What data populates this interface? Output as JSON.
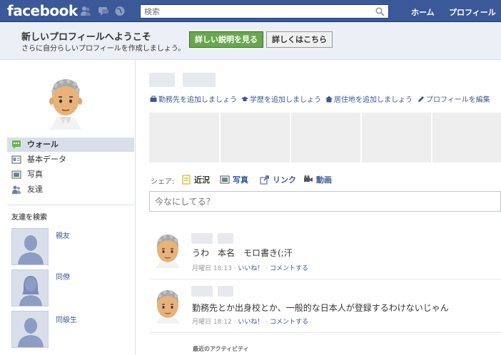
{
  "topbar": {
    "logo": "facebook",
    "search_placeholder": "検索",
    "nav_home": "ホーム",
    "nav_profile": "プロフィール",
    "bg_color": "#3b5998"
  },
  "welcome": {
    "title": "新しいプロフィールへようこそ",
    "subtitle": "さらに自分らしいプロフィールを作成しましょう。",
    "detail_button": "詳しい説明を見る",
    "more_button": "詳しくはこちら"
  },
  "profile": {
    "links": [
      {
        "icon": "briefcase-icon",
        "label": "勤務先を追加しましょう"
      },
      {
        "icon": "graduation-cap-icon",
        "label": "学歴を追加しましょう"
      },
      {
        "icon": "house-icon",
        "label": "居住地を追加しましょう"
      },
      {
        "icon": "pencil-icon",
        "label": "プロフィールを編集"
      }
    ]
  },
  "sidebar": {
    "items": [
      {
        "icon": "wall-icon",
        "label": "ウォール",
        "active": true
      },
      {
        "icon": "info-icon",
        "label": "基本データ"
      },
      {
        "icon": "photos-icon",
        "label": "写真"
      },
      {
        "icon": "friends-icon",
        "label": "友達"
      }
    ],
    "find_friends_title": "友達を検索",
    "friend_groups": [
      "親友",
      "同僚",
      "同級生"
    ]
  },
  "share": {
    "label": "シェア:",
    "options": [
      {
        "icon": "status-icon",
        "label": "近況",
        "active": true
      },
      {
        "icon": "photo-icon",
        "label": "写真"
      },
      {
        "icon": "link-icon",
        "label": "リンク"
      },
      {
        "icon": "video-icon",
        "label": "動画"
      }
    ],
    "status_placeholder": "今なにしてる？"
  },
  "posts": [
    {
      "text": "うわ　本名　モロ書き(;汗",
      "day": "月曜日",
      "time": "18:13",
      "like": "いいね！",
      "comment": "コメントする"
    },
    {
      "text": "勤務先とか出身校とか、一般的な日本人が登録するわけないじゃん",
      "day": "月曜日",
      "time": "18:12",
      "like": "いいね！",
      "comment": "コメントする"
    }
  ],
  "recent_activity": "最近のアクティビティ"
}
